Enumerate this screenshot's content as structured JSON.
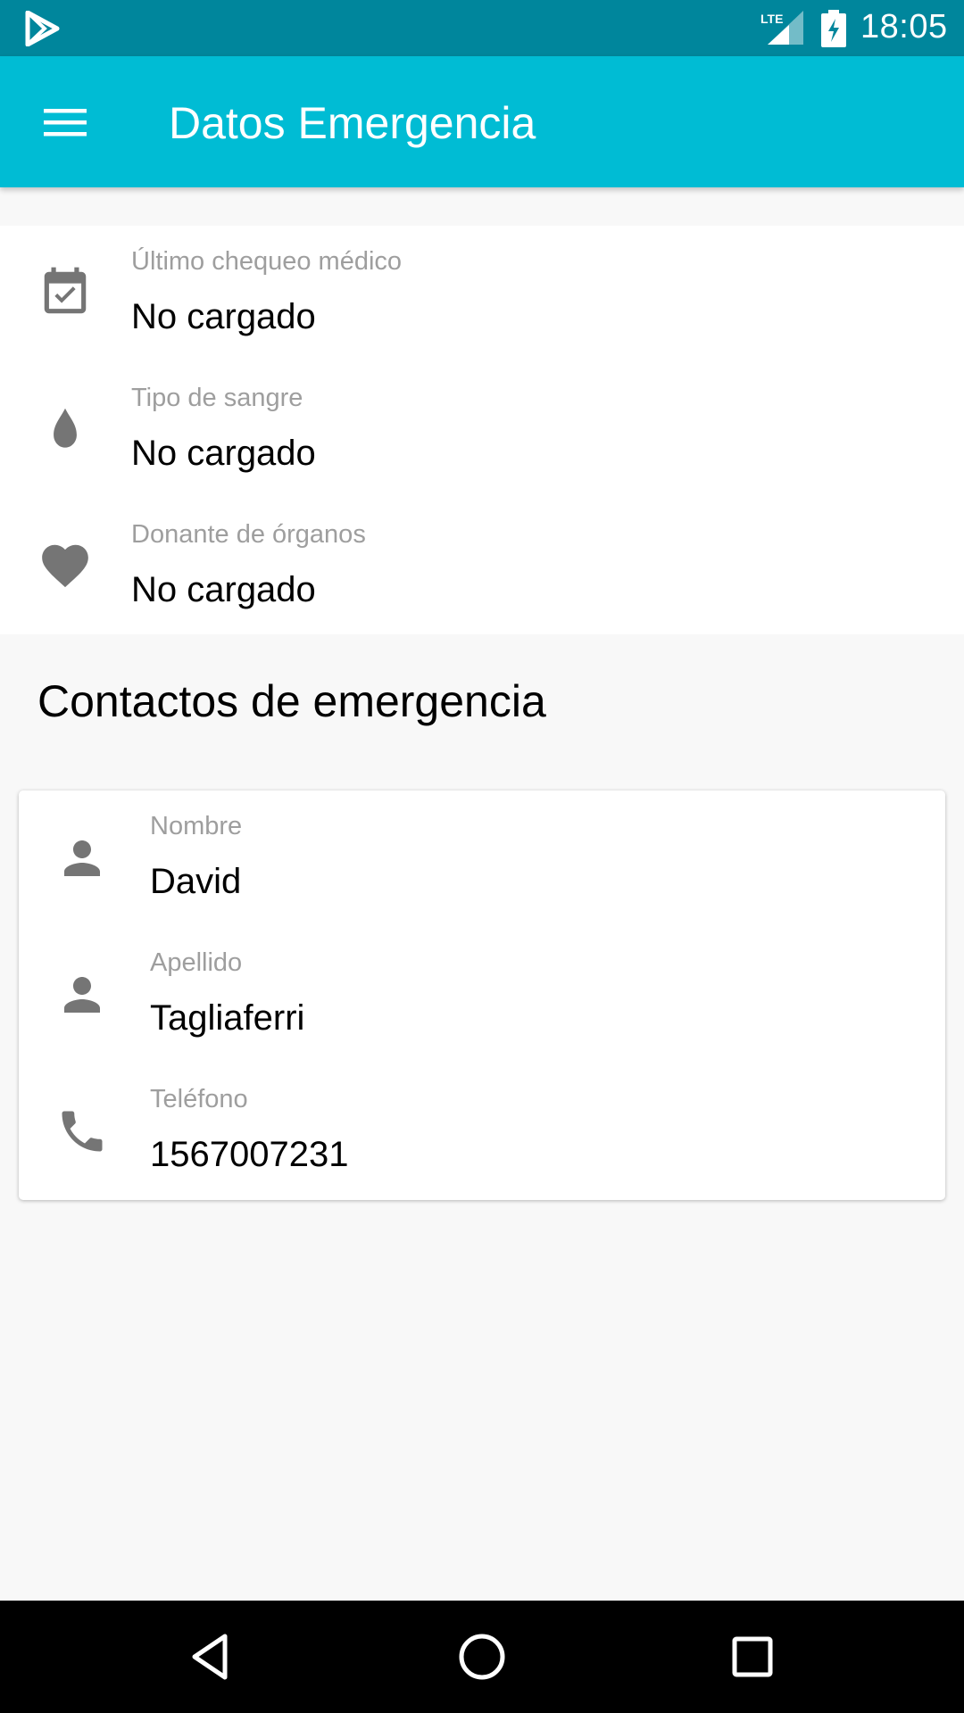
{
  "status_bar": {
    "time": "18:05",
    "network_label": "LTE",
    "icons": [
      "play-store-icon",
      "lte-signal-icon",
      "battery-charging-icon"
    ]
  },
  "app_bar": {
    "title": "Datos Emergencia",
    "menu_icon": "hamburger-menu-icon"
  },
  "medical_info": [
    {
      "icon": "calendar-check-icon",
      "label": "Último chequeo médico",
      "value": "No cargado"
    },
    {
      "icon": "drop-icon",
      "label": "Tipo de sangre",
      "value": "No cargado"
    },
    {
      "icon": "heart-icon",
      "label": "Donante de órganos",
      "value": "No cargado"
    }
  ],
  "contacts": {
    "title": "Contactos de emergencia",
    "fields": [
      {
        "icon": "person-icon",
        "label": "Nombre",
        "value": "David"
      },
      {
        "icon": "person-icon",
        "label": "Apellido",
        "value": "Tagliaferri"
      },
      {
        "icon": "phone-icon",
        "label": "Teléfono",
        "value": "1567007231"
      }
    ]
  },
  "nav_bar": {
    "buttons": [
      "back-icon",
      "home-icon",
      "recents-icon"
    ]
  },
  "colors": {
    "status_bar": "#00869c",
    "app_bar": "#00bcd4",
    "icon_gray": "#757575",
    "label_gray": "#9e9e9e",
    "background": "#f8f8f8"
  }
}
